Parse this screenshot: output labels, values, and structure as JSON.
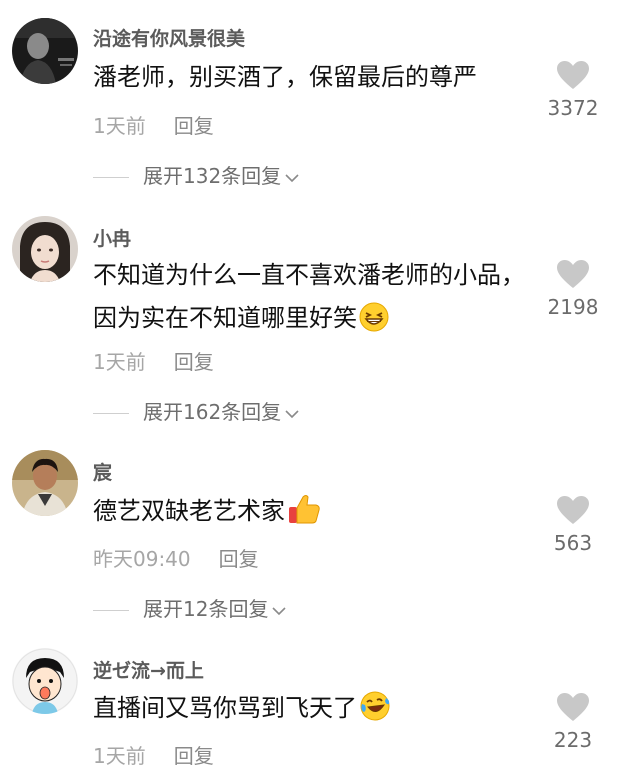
{
  "comments": [
    {
      "username": "沿途有你风景很美",
      "content": "潘老师，别买酒了，保留最后的尊严",
      "time": "1天前",
      "reply_label": "回复",
      "likes": "3372",
      "expand_label": "展开132条回复",
      "avatar_icon": "avatar-icon-dark-photo"
    },
    {
      "username": "小冉",
      "content": "不知道为什么一直不喜欢潘老师的小品，因为实在不知道哪里好笑",
      "emoji": "grinning-squint-emoji",
      "time": "1天前",
      "reply_label": "回复",
      "likes": "2198",
      "expand_label": "展开162条回复",
      "avatar_icon": "avatar-icon-girl-photo"
    },
    {
      "username": "宸",
      "content": "德艺双缺老艺术家",
      "emoji": "thumbs-up-emoji",
      "time": "昨天09:40",
      "reply_label": "回复",
      "likes": "563",
      "expand_label": "展开12条回复",
      "avatar_icon": "avatar-icon-man-photo"
    },
    {
      "username": "逆ゼ流→而上",
      "content": "直播间又骂你骂到飞天了",
      "emoji": "laughing-tears-emoji",
      "time": "1天前",
      "reply_label": "回复",
      "likes": "223",
      "avatar_icon": "avatar-icon-cartoon-boy"
    }
  ],
  "colors": {
    "username": "#5b5b5b",
    "meta": "#a6a6a6",
    "heart": "#c8c8c8"
  }
}
